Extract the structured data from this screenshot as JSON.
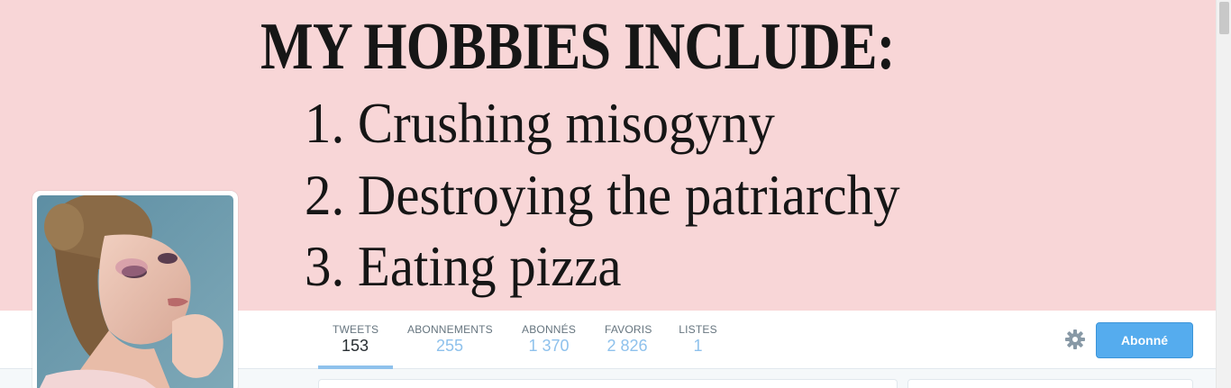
{
  "banner": {
    "title": "MY HOBBIES INCLUDE:",
    "lines": [
      "1. Crushing misogyny",
      "2. Destroying the patriarchy",
      "3. Eating pizza"
    ],
    "background_color": "#f8d6d7"
  },
  "profile": {
    "avatar_icon": "profile-photo"
  },
  "nav": {
    "items": [
      {
        "label": "TWEETS",
        "value": "153",
        "active": true
      },
      {
        "label": "ABONNEMENTS",
        "value": "255",
        "active": false
      },
      {
        "label": "ABONNÉS",
        "value": "1 370",
        "active": false
      },
      {
        "label": "FAVORIS",
        "value": "2 826",
        "active": false
      },
      {
        "label": "LISTES",
        "value": "1",
        "active": false
      }
    ]
  },
  "actions": {
    "settings_icon": "gear-icon",
    "follow_label": "Abonné",
    "accent_color": "#55acee"
  }
}
